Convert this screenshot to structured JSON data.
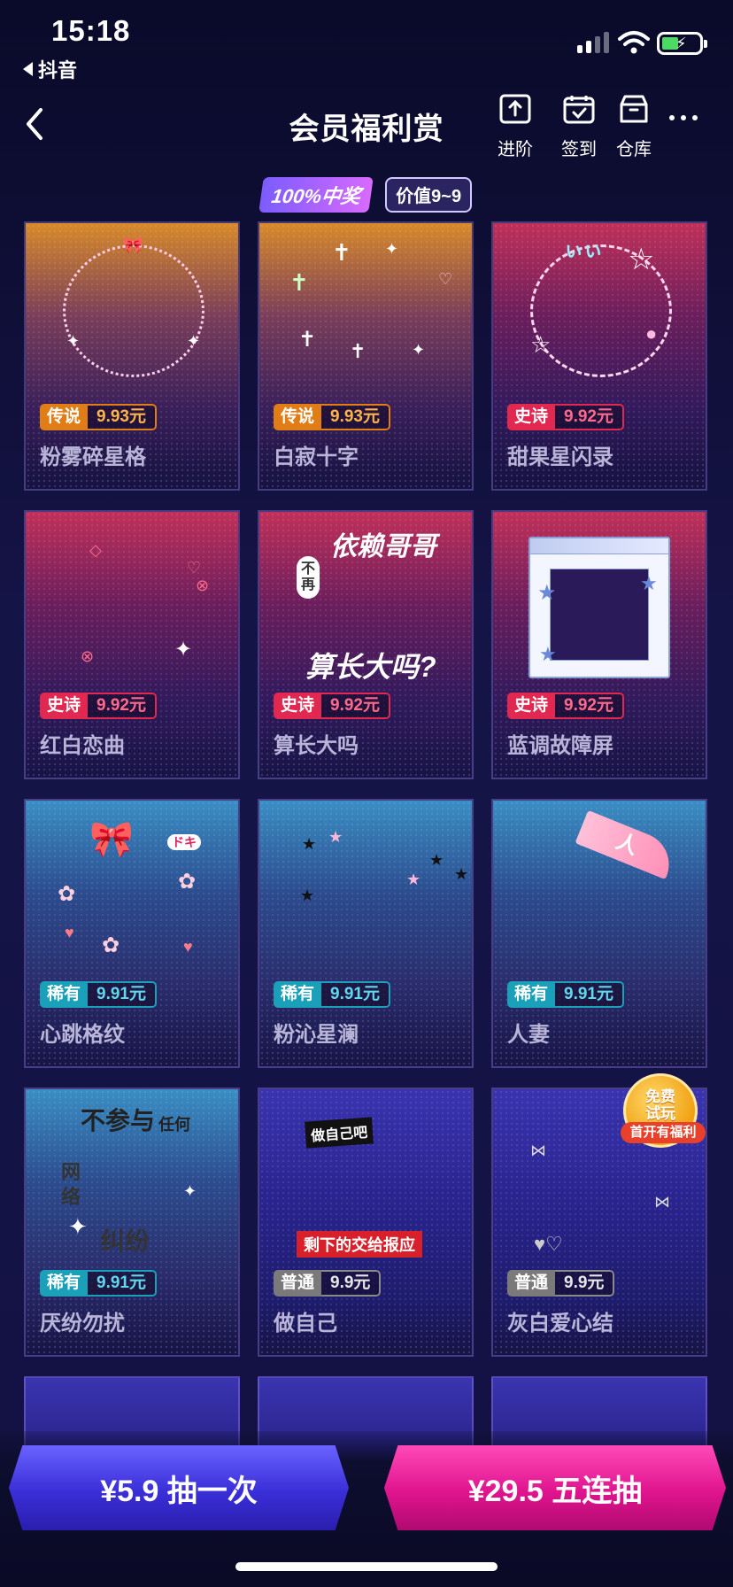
{
  "status": {
    "time": "15:18",
    "back_app": "抖音"
  },
  "nav": {
    "title": "会员福利赏",
    "actions": [
      {
        "label": "进阶",
        "icon": "upload-icon"
      },
      {
        "label": "签到",
        "icon": "calendar-check-icon"
      },
      {
        "label": "仓库",
        "icon": "box-icon"
      }
    ]
  },
  "banner": {
    "guarantee": "100%中奖",
    "value": "价值9~9"
  },
  "items": [
    {
      "level": "传说",
      "price": "9.93元",
      "name": "粉雾碎星格"
    },
    {
      "level": "传说",
      "price": "9.93元",
      "name": "白寂十字"
    },
    {
      "level": "史诗",
      "price": "9.92元",
      "name": "甜果星闪录"
    },
    {
      "level": "史诗",
      "price": "9.92元",
      "name": "红白恋曲"
    },
    {
      "level": "史诗",
      "price": "9.92元",
      "name": "算长大吗"
    },
    {
      "level": "史诗",
      "price": "9.92元",
      "name": "蓝调故障屏"
    },
    {
      "level": "稀有",
      "price": "9.91元",
      "name": "心跳格纹"
    },
    {
      "level": "稀有",
      "price": "9.91元",
      "name": "粉沁星澜"
    },
    {
      "level": "稀有",
      "price": "9.91元",
      "name": "人妻"
    },
    {
      "level": "稀有",
      "price": "9.91元",
      "name": "厌纷勿扰"
    },
    {
      "level": "普通",
      "price": "9.9元",
      "name": "做自己"
    },
    {
      "level": "普通",
      "price": "9.9元",
      "name": "灰白爱心结"
    }
  ],
  "art": {
    "item5_top": "依赖哥哥",
    "item5_side": "不再",
    "item5_bottom": "算长大吗?",
    "item10_a": "不参与",
    "item10_b": "任何",
    "item10_c": "网",
    "item10_d": "络",
    "item10_e": "纠纷",
    "item11_a": "做自己吧",
    "item11_b": "剩下的交给报应",
    "item9_a": "人"
  },
  "free_badge": {
    "title": "免费试玩",
    "sub": "首开有福利"
  },
  "buttons": {
    "one": "¥5.9 抽一次",
    "five": "¥29.5 五连抽"
  }
}
